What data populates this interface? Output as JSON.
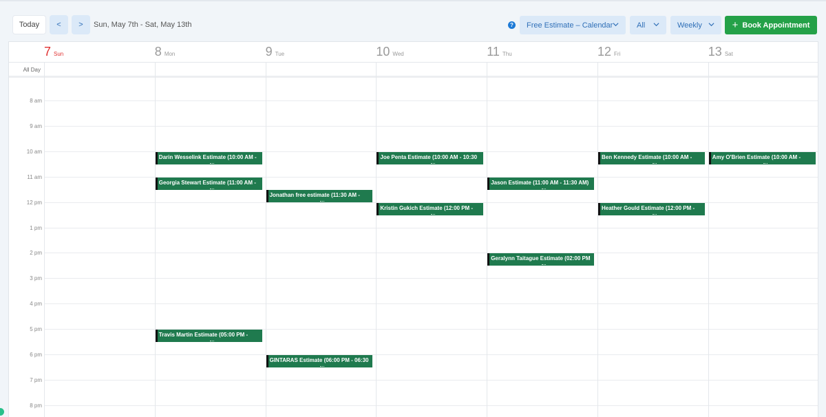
{
  "toolbar": {
    "today_label": "Today",
    "prev_label": "<",
    "next_label": ">",
    "date_range": "Sun, May 7th - Sat, May 13th",
    "help_label": "?",
    "calendar_select": "Free Estimate – Calendar",
    "filter_select": "All",
    "view_select": "Weekly",
    "book_label": "Book Appointment"
  },
  "days": [
    {
      "num": "7",
      "name": "Sun",
      "today": true
    },
    {
      "num": "8",
      "name": "Mon",
      "today": false
    },
    {
      "num": "9",
      "name": "Tue",
      "today": false
    },
    {
      "num": "10",
      "name": "Wed",
      "today": false
    },
    {
      "num": "11",
      "name": "Thu",
      "today": false
    },
    {
      "num": "12",
      "name": "Fri",
      "today": false
    },
    {
      "num": "13",
      "name": "Sat",
      "today": false
    }
  ],
  "all_day_label": "All Day",
  "hours": [
    "8 am",
    "9 am",
    "10 am",
    "11 am",
    "12 pm",
    "1 pm",
    "2 pm",
    "3 pm",
    "4 pm",
    "5 pm",
    "6 pm",
    "7 pm",
    "8 pm"
  ],
  "events": [
    {
      "title": "Darin Wesselink Estimate (10:00 AM -",
      "day": 1,
      "start": 10
    },
    {
      "title": "Georgia Stewart Estimate (11:00 AM -",
      "day": 1,
      "start": 11
    },
    {
      "title": "Travis Martin Estimate (05:00 PM -",
      "day": 1,
      "start": 17
    },
    {
      "title": "Jonathan free estimate (11:30 AM -",
      "day": 2,
      "start": 11.5
    },
    {
      "title": "GINTARAS Estimate (06:00 PM - 06:30",
      "day": 2,
      "start": 18
    },
    {
      "title": "Joe Penta Estimate (10:00 AM - 10:30",
      "day": 3,
      "start": 10
    },
    {
      "title": "Kristin Gukich Estimate (12:00 PM -",
      "day": 3,
      "start": 12
    },
    {
      "title": "Jason Estimate (11:00 AM - 11:30 AM)",
      "day": 4,
      "start": 11
    },
    {
      "title": "Geralynn Taitague Estimate (02:00 PM",
      "day": 4,
      "start": 14
    },
    {
      "title": "Ben Kennedy Estimate (10:00 AM -",
      "day": 5,
      "start": 10
    },
    {
      "title": "Heather Gould Estimate (12:00 PM -",
      "day": 5,
      "start": 12
    },
    {
      "title": "Amy O'Brien Estimate (10:00 AM -",
      "day": 6,
      "start": 10
    }
  ],
  "colors": {
    "event": "#1f7a4e",
    "today": "#e03030",
    "book": "#24a148",
    "accent": "#2f6fb7"
  }
}
